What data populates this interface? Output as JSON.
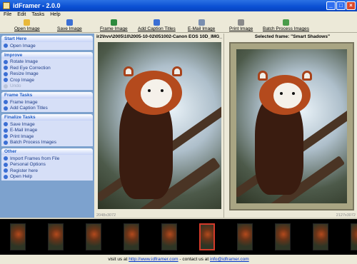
{
  "window": {
    "title": "idFramer - 2.0.0"
  },
  "menu": [
    "File",
    "Edit",
    "Tasks",
    "Help"
  ],
  "toolbar": [
    {
      "label": "Open Image",
      "icon": "folder-icon",
      "color": "#e8b83a"
    },
    {
      "label": "Save Image",
      "icon": "save-icon",
      "color": "#3b6fd4"
    },
    {
      "label": "Frame Image",
      "icon": "frame-icon",
      "color": "#2d8a3e"
    },
    {
      "label": "Add Caption Titles",
      "icon": "caption-icon",
      "color": "#3b6fd4"
    },
    {
      "label": "E-Mail Image",
      "icon": "email-icon",
      "color": "#7a8fb0"
    },
    {
      "label": "Print Image",
      "icon": "print-icon",
      "color": "#8a8a8a"
    },
    {
      "label": "Batch Process Images",
      "icon": "batch-icon",
      "color": "#4a9c4a"
    }
  ],
  "sidebar": [
    {
      "title": "Start Here",
      "items": [
        {
          "label": "Open Image",
          "enabled": true
        }
      ]
    },
    {
      "title": "Improve",
      "items": [
        {
          "label": "Rotate Image",
          "enabled": true
        },
        {
          "label": "Red Eye Correction",
          "enabled": true
        },
        {
          "label": "Resize Image",
          "enabled": true
        },
        {
          "label": "Crop Image",
          "enabled": true
        },
        {
          "label": "Undo",
          "enabled": false
        }
      ]
    },
    {
      "title": "Frame Tasks",
      "items": [
        {
          "label": "Frame Image",
          "enabled": true
        },
        {
          "label": "Add Caption Titles",
          "enabled": true
        }
      ]
    },
    {
      "title": "Finalize Tasks",
      "items": [
        {
          "label": "Save Image",
          "enabled": true
        },
        {
          "label": "E-Mail Image",
          "enabled": true
        },
        {
          "label": "Print Image",
          "enabled": true
        },
        {
          "label": "Batch Process Images",
          "enabled": true
        }
      ]
    },
    {
      "title": "Other",
      "items": [
        {
          "label": "Import Frames from File",
          "enabled": true
        },
        {
          "label": "Personal Options",
          "enabled": true
        },
        {
          "label": "Register here",
          "enabled": true
        },
        {
          "label": "Open Help",
          "enabled": true
        }
      ]
    }
  ],
  "left_pane": {
    "path": "ir2\\hvv\\2005\\10\\2005-10-02\\051002-Canon EOS 10D_IMG_",
    "dimensions": "2048x3072"
  },
  "right_pane": {
    "title": "Selected frame: \"Smart Shadows\"",
    "dimensions": "2127x3072"
  },
  "filmstrip": {
    "count": 10,
    "selected_index": 5
  },
  "status": {
    "prefix": "visit us at",
    "url": "http://www.idframer.com",
    "middle": "- contact us at",
    "email": "info@idframer.com"
  }
}
